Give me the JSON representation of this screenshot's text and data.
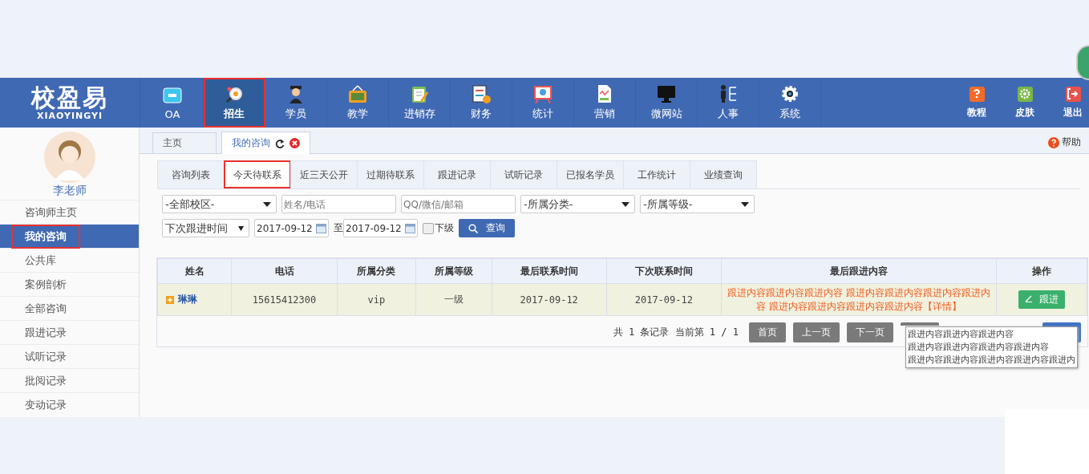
{
  "header": {
    "logo": {
      "title": "校盈易",
      "subtitle": "XIAOYINGYI"
    },
    "nav": [
      {
        "label": "OA",
        "selected": false,
        "highlighted": false
      },
      {
        "label": "招生",
        "selected": true,
        "highlighted": true
      },
      {
        "label": "学员",
        "selected": false,
        "highlighted": false
      },
      {
        "label": "教学",
        "selected": false,
        "highlighted": false
      },
      {
        "label": "进销存",
        "selected": false,
        "highlighted": false
      },
      {
        "label": "财务",
        "selected": false,
        "highlighted": false
      },
      {
        "label": "统计",
        "selected": false,
        "highlighted": false
      },
      {
        "label": "营销",
        "selected": false,
        "highlighted": false
      },
      {
        "label": "微网站",
        "selected": false,
        "highlighted": false
      },
      {
        "label": "人事",
        "selected": false,
        "highlighted": false
      },
      {
        "label": "系统",
        "selected": false,
        "highlighted": false
      }
    ],
    "tools": [
      {
        "label": "教程",
        "color": "#f26b2a"
      },
      {
        "label": "皮肤",
        "color": "#7ab648"
      },
      {
        "label": "退出",
        "color": "#e9514b"
      }
    ]
  },
  "sidebar": {
    "user": "李老师",
    "items": [
      {
        "label": "咨询师主页",
        "selected": false,
        "highlighted": false
      },
      {
        "label": "我的咨询",
        "selected": true,
        "highlighted": true
      },
      {
        "label": "公共库",
        "selected": false,
        "highlighted": false
      },
      {
        "label": "案例剖析",
        "selected": false,
        "highlighted": false
      },
      {
        "label": "全部咨询",
        "selected": false,
        "highlighted": false
      },
      {
        "label": "跟进记录",
        "selected": false,
        "highlighted": false
      },
      {
        "label": "试听记录",
        "selected": false,
        "highlighted": false
      },
      {
        "label": "批阅记录",
        "selected": false,
        "highlighted": false
      },
      {
        "label": "变动记录",
        "selected": false,
        "highlighted": false
      }
    ]
  },
  "page_tabs": [
    {
      "label": "主页",
      "selected": false,
      "closable": false
    },
    {
      "label": "我的咨询",
      "selected": true,
      "closable": true
    }
  ],
  "help": "帮助",
  "sub_tabs": [
    {
      "label": "咨询列表",
      "selected": false,
      "highlighted": false
    },
    {
      "label": "今天待联系",
      "selected": true,
      "highlighted": true
    },
    {
      "label": "近三天公开",
      "selected": false,
      "highlighted": false
    },
    {
      "label": "过期待联系",
      "selected": false,
      "highlighted": false
    },
    {
      "label": "跟进记录",
      "selected": false,
      "highlighted": false
    },
    {
      "label": "试听记录",
      "selected": false,
      "highlighted": false
    },
    {
      "label": "已报名学员",
      "selected": false,
      "highlighted": false
    },
    {
      "label": "工作统计",
      "selected": false,
      "highlighted": false
    },
    {
      "label": "业绩查询",
      "selected": false,
      "highlighted": false
    }
  ],
  "filters": {
    "campus": "-全部校区-",
    "name_placeholder": "姓名/电话",
    "contact_placeholder": "QQ/微信/邮箱",
    "category": "-所属分类-",
    "level": "-所属等级-",
    "time_type": "下次跟进时间",
    "date_from": "2017-09-12",
    "date_to_label": "至",
    "date_to": "2017-09-12",
    "sub_level": {
      "label": "下级",
      "checked": false
    },
    "search_button": "查询"
  },
  "table": {
    "columns": [
      "姓名",
      "电话",
      "所属分类",
      "所属等级",
      "最后联系时间",
      "下次联系时间",
      "最后跟进内容",
      "操作"
    ],
    "rows": [
      {
        "name": "琳琳",
        "phone": "15615412300",
        "category": "vip",
        "level": "一级",
        "last_contact": "2017-09-12",
        "next_contact": "2017-09-12",
        "last_followup": "跟进内容跟进内容跟进内容 跟进内容跟进内容跟进内容跟进内容 跟进内容跟进内容跟进内容跟进内容",
        "detail_link": "【详情】",
        "action": "跟进"
      }
    ]
  },
  "pagination": {
    "summary": "共 1 条记录 当前第 1 / 1",
    "buttons": [
      "首页",
      "上一页",
      "下一页"
    ]
  },
  "tooltip": {
    "lines": [
      "跟进内容跟进内容跟进内容",
      "跟进内容跟进内容跟进内容跟进内容",
      "跟进内容跟进内容跟进内容跟进内容跟进内"
    ]
  }
}
